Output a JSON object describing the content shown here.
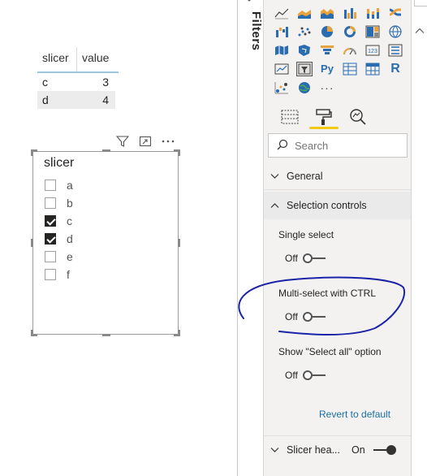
{
  "table": {
    "headers": [
      "slicer",
      "value"
    ],
    "rows": [
      {
        "slicer": "c",
        "value": "3"
      },
      {
        "slicer": "d",
        "value": "4"
      }
    ]
  },
  "slicer": {
    "title": "slicer",
    "items": [
      {
        "label": "a",
        "checked": false
      },
      {
        "label": "b",
        "checked": false
      },
      {
        "label": "c",
        "checked": true
      },
      {
        "label": "d",
        "checked": true
      },
      {
        "label": "e",
        "checked": false
      },
      {
        "label": "f",
        "checked": false
      }
    ]
  },
  "visual_header_icons": [
    "filter-icon",
    "focus-mode-icon",
    "more-options-icon"
  ],
  "filters_pane": {
    "label": "Filters"
  },
  "viz_pane": {
    "visual_icons": [
      "line-chart",
      "area-chart",
      "stacked-area-chart",
      "clustered-column-chart",
      "stacked-column-chart",
      "ribbon-chart",
      "waterfall-chart",
      "scatter-chart",
      "pie-chart",
      "donut-chart",
      "treemap",
      "map",
      "filled-map",
      "shape-map",
      "funnel",
      "gauge",
      "card",
      "multi-row-card",
      "kpi",
      "slicer",
      "python-visual",
      "table",
      "matrix",
      "r-visual",
      "key-influencers",
      "arcgis-map",
      "more-visuals"
    ],
    "python_label": "Py",
    "r_label": "R",
    "more_label": "···",
    "tabs": [
      "fields-tab",
      "format-tab",
      "analytics-tab"
    ],
    "search_placeholder": "Search",
    "sections": {
      "general": "General",
      "selection_controls": "Selection controls",
      "slicer_header": "Slicer hea...",
      "slicer_header_state": "On"
    },
    "properties": [
      {
        "label": "Single select",
        "state": "Off"
      },
      {
        "label": "Multi-select with CTRL",
        "state": "Off"
      },
      {
        "label": "Show \"Select all\" option",
        "state": "Off"
      }
    ],
    "revert_label": "Revert to default"
  },
  "annotation": {
    "color": "#1a23a8"
  }
}
